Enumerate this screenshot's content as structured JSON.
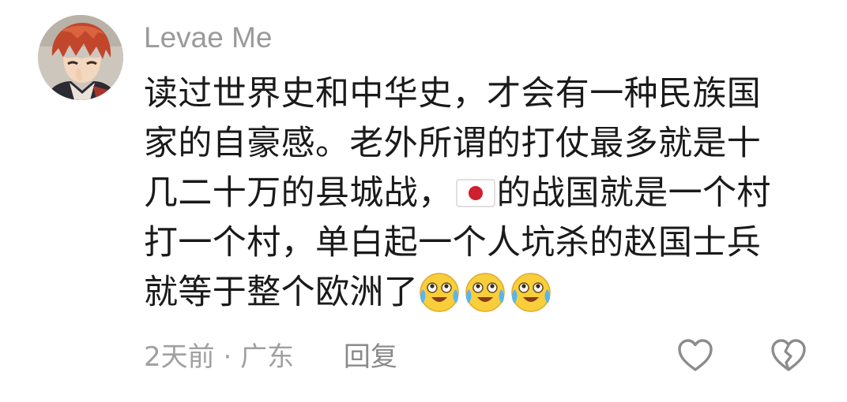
{
  "comment": {
    "username": "Levae Me",
    "avatar_icon": "anime-avatar",
    "lines": [
      "读过世界史和中华史，才会有一种民族国",
      "家的自豪感。老外所谓的打仗最多就是十",
      "几二十万的县城战，",
      "的战国就是一个村",
      "打一个村，单白起一个人坑杀的赵国士兵",
      "就等于整个欧洲了"
    ],
    "inline_icons": {
      "flag": "japan-flag-emoji",
      "emoji": "crying-laughing-emoji"
    },
    "time": "2天前",
    "separator": "·",
    "location": "广东",
    "reply_label": "回复",
    "like_icon": "heart-outline-icon",
    "dislike_icon": "broken-heart-icon"
  }
}
